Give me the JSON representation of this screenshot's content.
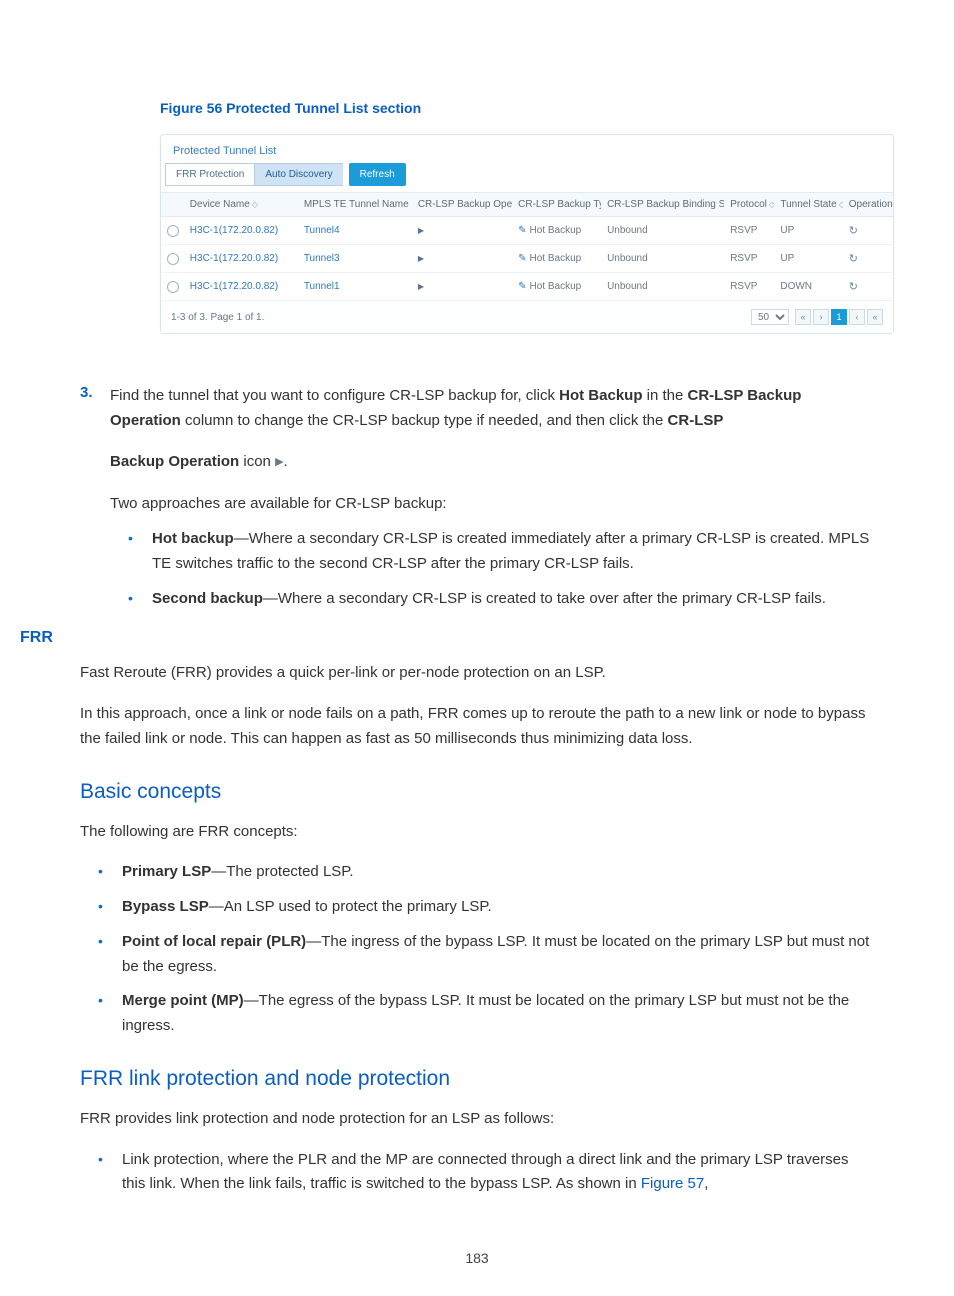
{
  "figure_caption": "Figure 56 Protected Tunnel List section",
  "panel": {
    "title": "Protected Tunnel List",
    "tabs": {
      "frr": "FRR Protection",
      "auto": "Auto Discovery"
    },
    "refresh_label": "Refresh",
    "headers": {
      "device": "Device Name",
      "tunnel": "MPLS TE Tunnel Name",
      "bkop": "CR-LSP Backup Operation",
      "bktype": "CR-LSP Backup Type",
      "bind": "CR-LSP Backup Binding State",
      "protocol": "Protocol",
      "tstate": "Tunnel State",
      "op": "Operation"
    },
    "rows": [
      {
        "device": "H3C-1(172.20.0.82)",
        "tunnel": "Tunnel4",
        "bktype": "Hot Backup",
        "bind": "Unbound",
        "protocol": "RSVP",
        "tstate": "UP"
      },
      {
        "device": "H3C-1(172.20.0.82)",
        "tunnel": "Tunnel3",
        "bktype": "Hot Backup",
        "bind": "Unbound",
        "protocol": "RSVP",
        "tstate": "UP"
      },
      {
        "device": "H3C-1(172.20.0.82)",
        "tunnel": "Tunnel1",
        "bktype": "Hot Backup",
        "bind": "Unbound",
        "protocol": "RSVP",
        "tstate": "DOWN"
      }
    ],
    "footer_status": "1-3 of 3. Page 1 of 1.",
    "page_size": "50",
    "current_page": "1"
  },
  "step3": {
    "num": "3.",
    "line1a": "Find the tunnel that you want to configure CR-LSP backup for, click ",
    "hot_backup": "Hot Backup",
    "line1b": " in the ",
    "crlsp_bk_op1": "CR-LSP Backup Operation",
    "line1c": " column to change the CR-LSP backup type if needed, and then click the ",
    "crlsp2": "CR-LSP",
    "bk_op_icon_label": "Backup Operation",
    "icon_suffix": " icon ",
    "period": "."
  },
  "approaches_intro": "Two approaches are available for CR-LSP backup:",
  "approaches": [
    {
      "term": "Hot backup",
      "desc": "—Where a secondary CR-LSP is created immediately after a primary CR-LSP is created. MPLS TE switches traffic to the second CR-LSP after the primary CR-LSP fails."
    },
    {
      "term": "Second backup",
      "desc": "—Where a secondary CR-LSP is created to take over after the primary CR-LSP fails."
    }
  ],
  "frr_heading": "FRR",
  "frr_p1": "Fast Reroute (FRR) provides a quick per-link or per-node protection on an LSP.",
  "frr_p2": "In this approach, once a link or node fails on a path, FRR comes up to reroute the path to a new link or node to bypass the failed link or node. This can happen as fast as 50 milliseconds thus minimizing data loss.",
  "basic_concepts_heading": "Basic concepts",
  "bc_intro": "The following are FRR concepts:",
  "bc_items": [
    {
      "term": "Primary LSP",
      "desc": "—The protected LSP."
    },
    {
      "term": "Bypass LSP",
      "desc": "—An LSP used to protect the primary LSP."
    },
    {
      "term": "Point of local repair (PLR)",
      "desc": "—The ingress of the bypass LSP. It must be located on the primary LSP but must not be the egress."
    },
    {
      "term": "Merge point (MP)",
      "desc": "—The egress of the bypass LSP. It must be located on the primary LSP but must not be the ingress."
    }
  ],
  "frr_link_heading": "FRR link protection and node protection",
  "frr_link_intro": "FRR provides link protection and node protection for an LSP as follows:",
  "frr_link_item_a": "Link protection, where the PLR and the MP are connected through a direct link and the primary LSP traverses this link. When the link fails, traffic is switched to the bypass LSP. As shown in ",
  "frr_link_item_ref": "Figure 57",
  "frr_link_item_b": ",",
  "page_number": "183"
}
